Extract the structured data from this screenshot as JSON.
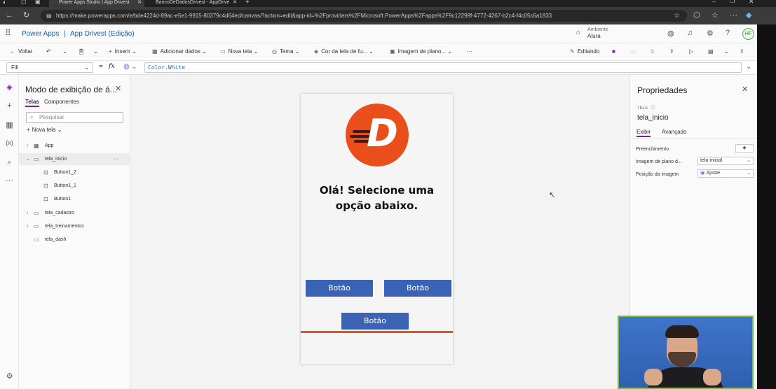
{
  "browser": {
    "tabs": [
      {
        "label": "Power Apps Studio | App Drivest",
        "active": true
      },
      {
        "label": "BancoDeDadosDrivest - AppDrive",
        "active": false
      }
    ],
    "url": "https://make.powerapps.com/e/bde4224d-89ac-e5e1-9915-80379c4d64ed/canvas/?action=edit&app-id=%2Fproviders%2FMicrosoft.PowerApps%2Fapps%2F9c12299f-4772-4267-b2c4-f4c05c6a1833"
  },
  "header": {
    "product": "Power Apps",
    "separator": "|",
    "app_title": "App Drivest (Edição)",
    "environment_label": "Ambiente",
    "environment_name": "Alura",
    "avatar_initials": "HF"
  },
  "toolbar": {
    "back": "Voltar",
    "insert": "Inserir",
    "add_data": "Adicionar dados",
    "new_screen": "Nova tela",
    "theme": "Tema",
    "screen_color": "Cor da tela de fu...",
    "bg_image": "Imagem de plano...",
    "more": "···",
    "editing": "Editando"
  },
  "formula": {
    "property": "Fill",
    "fx": "fx",
    "equals": "=",
    "value": "Color.White"
  },
  "tree": {
    "title": "Modo de exibição de á...",
    "tabs": [
      "Telas",
      "Componentes"
    ],
    "search_placeholder": "Pesquisar",
    "new_screen": "Nova tela",
    "nodes": [
      {
        "label": "App"
      },
      {
        "label": "tela_inicio",
        "more": "···"
      },
      {
        "label": "Button1_2"
      },
      {
        "label": "Button1_1"
      },
      {
        "label": "Button1"
      },
      {
        "label": "tela_cadastro"
      },
      {
        "label": "tela_treinamentos"
      },
      {
        "label": "tela_dash"
      }
    ]
  },
  "canvas": {
    "logo_letter": "D",
    "headline_line1": "Olá! Selecione uma",
    "headline_line2": "opção abaixo.",
    "buttons": [
      "Botão",
      "Botão",
      "Botão"
    ],
    "accent_color": "#e94e1b",
    "button_color": "#3b63b5"
  },
  "properties": {
    "title": "Propriedades",
    "type": "TELA",
    "name": "tela_inicio",
    "tabs": [
      "Exibir",
      "Avançado"
    ],
    "fill_label": "Preenchimento",
    "bg_image_label": "Imagem de plano d...",
    "bg_image_value": "tela-inicial",
    "image_position_label": "Posição da imagem",
    "image_position_value": "Ajuste"
  }
}
